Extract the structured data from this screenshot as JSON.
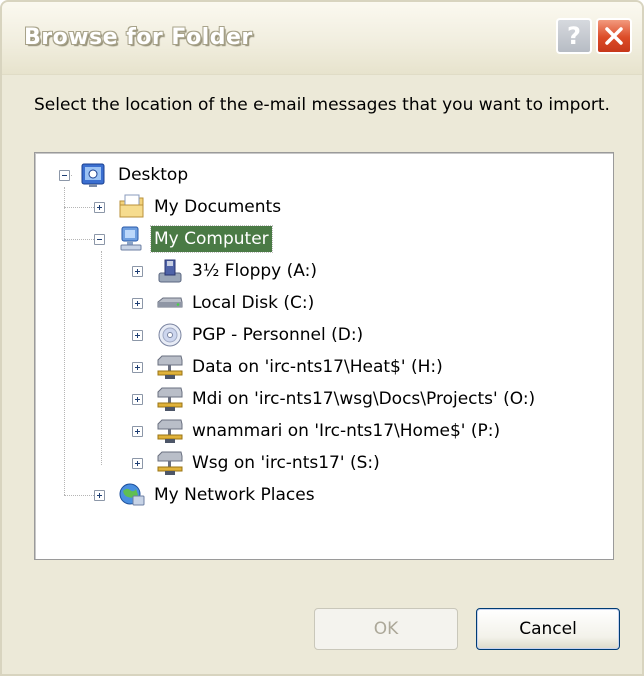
{
  "window": {
    "title": "Browse for Folder",
    "help_glyph": "?",
    "close_icon": "close-icon"
  },
  "instruction": "Select the location of the e-mail messages that you want to import.",
  "tree": {
    "root": {
      "label": "Desktop",
      "icon": "desktop-icon",
      "expanded": true
    },
    "documents": {
      "label": "My Documents",
      "icon": "my-documents-icon",
      "expanded": false
    },
    "computer": {
      "label": "My Computer",
      "icon": "my-computer-icon",
      "expanded": true,
      "selected": true
    },
    "drives": [
      {
        "label": "3½ Floppy (A:)",
        "icon": "floppy-drive-icon"
      },
      {
        "label": "Local Disk (C:)",
        "icon": "hard-disk-icon"
      },
      {
        "label": "PGP - Personnel (D:)",
        "icon": "cd-drive-icon"
      },
      {
        "label": "Data on 'irc-nts17\\Heat$' (H:)",
        "icon": "network-drive-icon"
      },
      {
        "label": "Mdi on 'irc-nts17\\wsg\\Docs\\Projects' (O:)",
        "icon": "network-drive-icon"
      },
      {
        "label": "wnammari on 'Irc-nts17\\Home$' (P:)",
        "icon": "network-drive-icon"
      },
      {
        "label": "Wsg on 'irc-nts17' (S:)",
        "icon": "network-drive-icon"
      }
    ],
    "network": {
      "label": "My Network Places",
      "icon": "network-places-icon",
      "expanded": false
    }
  },
  "buttons": {
    "ok": {
      "label": "OK",
      "enabled": false
    },
    "cancel": {
      "label": "Cancel",
      "enabled": true
    }
  },
  "colors": {
    "dialog_background": "#ece9d8",
    "selection": "#4a7a45",
    "button_border": "#003c74"
  }
}
